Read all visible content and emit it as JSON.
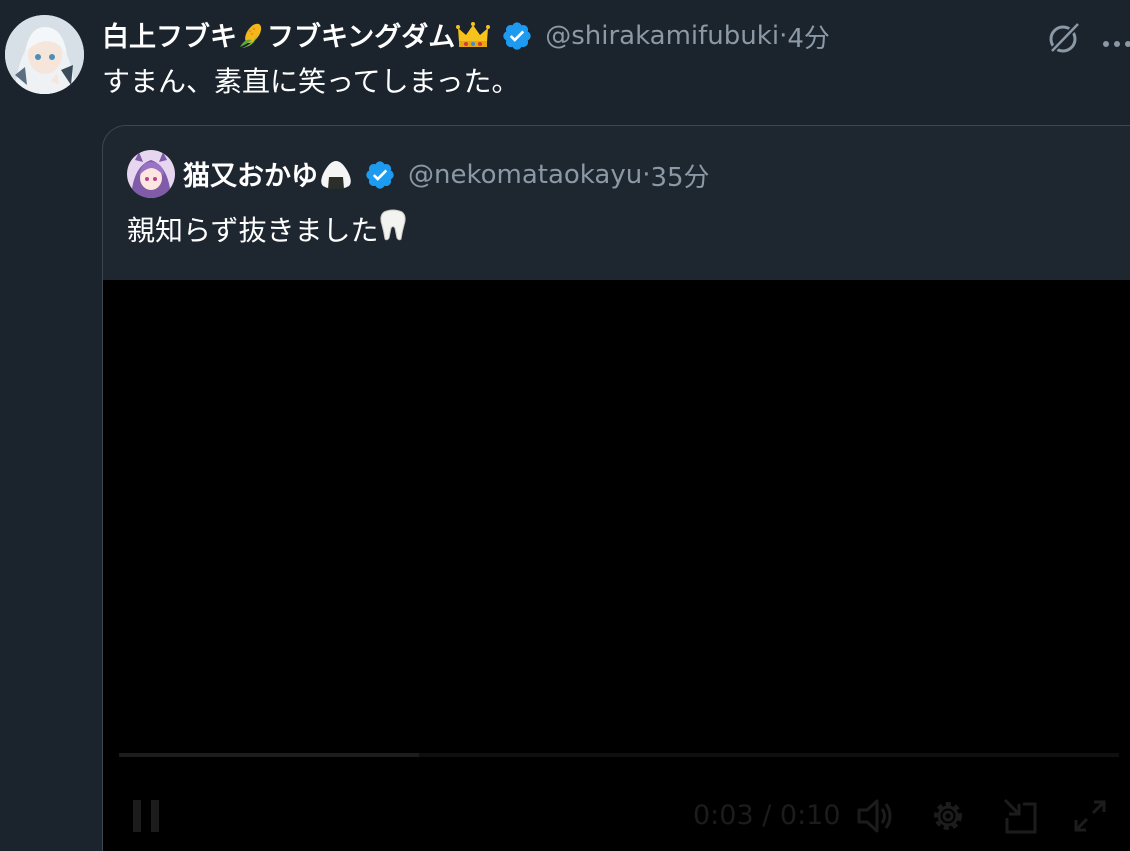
{
  "tweet": {
    "display_name_part1": "白上フブキ",
    "display_name_part2": "フブキングダム",
    "handle": "@shirakamifubuki",
    "separator": " · ",
    "time": "4分",
    "text": "すまん、素直に笑ってしまった。"
  },
  "quote": {
    "display_name": "猫又おかゆ",
    "handle": "@nekomataokayu",
    "separator": " · ",
    "time": "35分",
    "text": "親知らず抜きました"
  },
  "video": {
    "time_display": "0:03 / 0:10",
    "progress_fraction": 0.3
  },
  "icons": {
    "verified": "verified-badge-icon",
    "corn": "corn-emoji",
    "crown": "crown-emoji",
    "onigiri": "onigiri-emoji",
    "tooth": "tooth-emoji",
    "grok": "grok-icon",
    "more": "more-dots-icon",
    "pause": "pause-icon",
    "volume": "volume-icon",
    "settings": "gear-icon",
    "pip": "picture-in-picture-icon",
    "fullscreen": "fullscreen-icon"
  },
  "colors": {
    "background": "#1b232d",
    "verified_blue": "#1d9bf0",
    "muted_text": "#8b98a5"
  }
}
